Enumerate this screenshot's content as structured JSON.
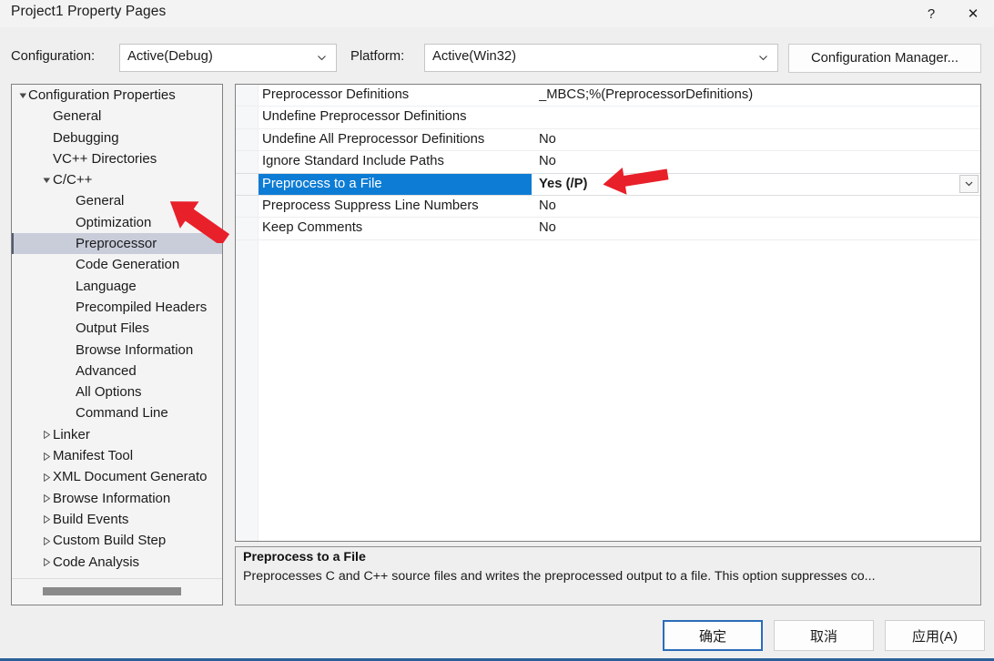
{
  "window": {
    "title": "Project1 Property Pages",
    "help_button": "?",
    "close_button": "✕"
  },
  "config_bar": {
    "configuration_label": "Configuration:",
    "configuration_value": "Active(Debug)",
    "platform_label": "Platform:",
    "platform_value": "Active(Win32)",
    "configuration_manager_label": "Configuration Manager..."
  },
  "tree": {
    "items": [
      {
        "label": "Configuration Properties",
        "depth": 0,
        "twisty": "expanded",
        "selected": false
      },
      {
        "label": "General",
        "depth": 1,
        "twisty": "none",
        "selected": false
      },
      {
        "label": "Debugging",
        "depth": 1,
        "twisty": "none",
        "selected": false
      },
      {
        "label": "VC++ Directories",
        "depth": 1,
        "twisty": "none",
        "selected": false
      },
      {
        "label": "C/C++",
        "depth": 1,
        "twisty": "expanded",
        "selected": false
      },
      {
        "label": "General",
        "depth": 2,
        "twisty": "none",
        "selected": false
      },
      {
        "label": "Optimization",
        "depth": 2,
        "twisty": "none",
        "selected": false
      },
      {
        "label": "Preprocessor",
        "depth": 2,
        "twisty": "none",
        "selected": true
      },
      {
        "label": "Code Generation",
        "depth": 2,
        "twisty": "none",
        "selected": false
      },
      {
        "label": "Language",
        "depth": 2,
        "twisty": "none",
        "selected": false
      },
      {
        "label": "Precompiled Headers",
        "depth": 2,
        "twisty": "none",
        "selected": false
      },
      {
        "label": "Output Files",
        "depth": 2,
        "twisty": "none",
        "selected": false
      },
      {
        "label": "Browse Information",
        "depth": 2,
        "twisty": "none",
        "selected": false
      },
      {
        "label": "Advanced",
        "depth": 2,
        "twisty": "none",
        "selected": false
      },
      {
        "label": "All Options",
        "depth": 2,
        "twisty": "none",
        "selected": false
      },
      {
        "label": "Command Line",
        "depth": 2,
        "twisty": "none",
        "selected": false
      },
      {
        "label": "Linker",
        "depth": 1,
        "twisty": "collapsed",
        "selected": false
      },
      {
        "label": "Manifest Tool",
        "depth": 1,
        "twisty": "collapsed",
        "selected": false
      },
      {
        "label": "XML Document Generato",
        "depth": 1,
        "twisty": "collapsed",
        "selected": false
      },
      {
        "label": "Browse Information",
        "depth": 1,
        "twisty": "collapsed",
        "selected": false
      },
      {
        "label": "Build Events",
        "depth": 1,
        "twisty": "collapsed",
        "selected": false
      },
      {
        "label": "Custom Build Step",
        "depth": 1,
        "twisty": "collapsed",
        "selected": false
      },
      {
        "label": "Code Analysis",
        "depth": 1,
        "twisty": "collapsed",
        "selected": false
      }
    ]
  },
  "grid": {
    "rows": [
      {
        "name": "Preprocessor Definitions",
        "value": "_MBCS;%(PreprocessorDefinitions)",
        "selected": false,
        "dropdown": false
      },
      {
        "name": "Undefine Preprocessor Definitions",
        "value": "",
        "selected": false,
        "dropdown": false
      },
      {
        "name": "Undefine All Preprocessor Definitions",
        "value": "No",
        "selected": false,
        "dropdown": false
      },
      {
        "name": "Ignore Standard Include Paths",
        "value": "No",
        "selected": false,
        "dropdown": false
      },
      {
        "name": "Preprocess to a File",
        "value": "Yes (/P)",
        "selected": true,
        "dropdown": true
      },
      {
        "name": "Preprocess Suppress Line Numbers",
        "value": "No",
        "selected": false,
        "dropdown": false
      },
      {
        "name": "Keep Comments",
        "value": "No",
        "selected": false,
        "dropdown": false
      }
    ]
  },
  "description": {
    "title": "Preprocess to a File",
    "text": "Preprocesses C and C++ source files and writes the preprocessed output to a file. This option suppresses co..."
  },
  "buttons": {
    "ok": "确定",
    "cancel": "取消",
    "apply": "应用(A)"
  },
  "annotations": {
    "arrow_color": "#e8202a",
    "arrow_tree_target": "Preprocessor",
    "arrow_grid_target": "Yes (/P)"
  },
  "colors": {
    "selection_blue": "#0d7cd4",
    "tree_selection": "#c9cdda",
    "dialog_background": "#efeff0",
    "window_accent": "#2a6099"
  }
}
